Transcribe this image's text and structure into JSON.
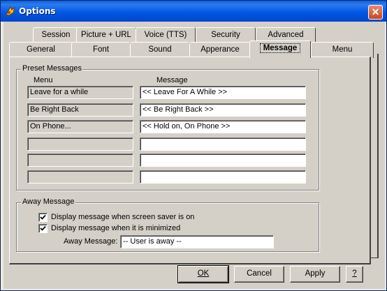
{
  "window": {
    "title": "Options",
    "close_label": "✕"
  },
  "tabs_back_row": [
    {
      "label": "Session"
    },
    {
      "label": "Picture + URL"
    },
    {
      "label": "Voice (TTS)"
    },
    {
      "label": "Security"
    },
    {
      "label": "Advanced"
    }
  ],
  "tabs_front_row": [
    {
      "label": "General"
    },
    {
      "label": "Font"
    },
    {
      "label": "Sound"
    },
    {
      "label": "Apperance"
    },
    {
      "label": "Message",
      "active": true
    },
    {
      "label": "Menu"
    }
  ],
  "preset": {
    "group_title": "Preset Messages",
    "col_menu": "Menu",
    "col_message": "Message",
    "rows": [
      {
        "menu": "Leave for a while",
        "message": "<< Leave For A While >>"
      },
      {
        "menu": "Be Right Back",
        "message": "<< Be Right Back >>"
      },
      {
        "menu": "On Phone...",
        "message": "<< Hold on,  On Phone >>"
      },
      {
        "menu": "",
        "message": ""
      },
      {
        "menu": "",
        "message": ""
      },
      {
        "menu": "",
        "message": ""
      }
    ]
  },
  "away": {
    "group_title": "Away Message",
    "opt_screensaver": {
      "label": "Display message when screen saver is on",
      "checked": true
    },
    "opt_minimized": {
      "label": "Display message when it is minimized",
      "checked": true
    },
    "field_label": "Away Message:",
    "field_value": "-- User is away --"
  },
  "buttons": {
    "ok": "OK",
    "cancel": "Cancel",
    "apply": "Apply",
    "help": "?"
  }
}
